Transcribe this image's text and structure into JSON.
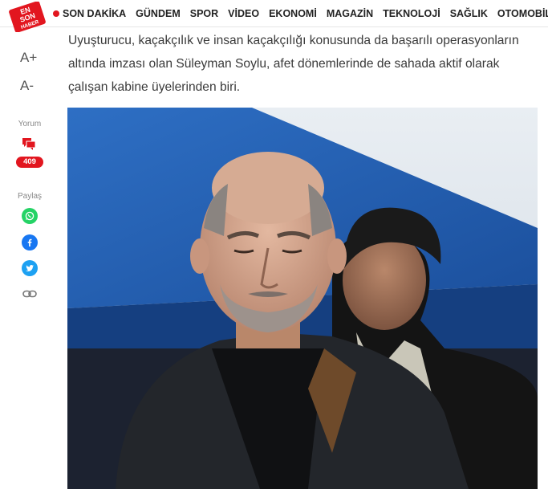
{
  "logo": {
    "alt": "EN SON HABER",
    "line1": "EN",
    "line2": "SON",
    "line3": "HABER"
  },
  "nav": {
    "items": [
      {
        "label": "SON DAKİKA",
        "live": true
      },
      {
        "label": "GÜNDEM"
      },
      {
        "label": "SPOR"
      },
      {
        "label": "VİDEO"
      },
      {
        "label": "EKONOMİ"
      },
      {
        "label": "MAGAZİN"
      },
      {
        "label": "TEKNOLOJİ"
      },
      {
        "label": "SAĞLIK"
      },
      {
        "label": "OTOMOBİL"
      }
    ]
  },
  "tools": {
    "font_increase": "A+",
    "font_decrease": "A-",
    "comment_label": "Yorum",
    "comment_count": "409",
    "share_label": "Paylaş",
    "share": [
      "whatsapp-icon",
      "facebook-icon",
      "twitter-icon",
      "link-icon"
    ]
  },
  "article": {
    "paragraph": "Uyuşturucu, kaçakçılık ve insan kaçakçılığı konusunda da başarılı operasyonların altında imzası olan Süleyman Soylu, afet dönemlerinde de sahada aktif olarak çalışan kabine üyelerinden biri."
  },
  "colors": {
    "brand_red": "#e2161f",
    "whatsapp": "#25d366",
    "facebook": "#1877f2",
    "twitter": "#1da1f2"
  }
}
